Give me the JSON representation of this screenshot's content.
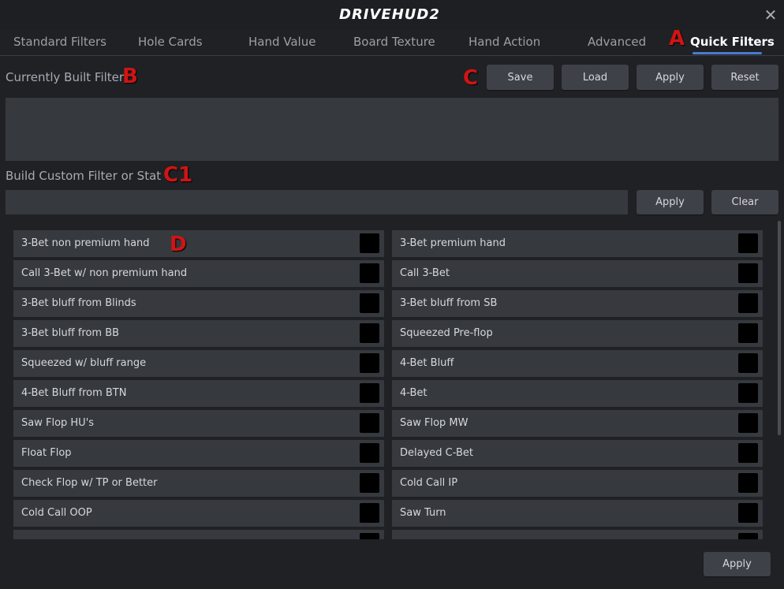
{
  "app": {
    "logo_text": "DRIVEHUD2",
    "close_glyph": "✕"
  },
  "tabs": [
    {
      "label": "Standard Filters"
    },
    {
      "label": "Hole Cards"
    },
    {
      "label": "Hand Value"
    },
    {
      "label": "Board Texture"
    },
    {
      "label": "Hand Action"
    },
    {
      "label": "Advanced"
    },
    {
      "label": "Quick Filters",
      "active": true
    }
  ],
  "markers": {
    "a": "A",
    "b": "B",
    "c": "C",
    "c1": "C1",
    "d": "D"
  },
  "current_filter": {
    "label": "Currently Built Filter",
    "buttons": {
      "save": "Save",
      "load": "Load",
      "apply": "Apply",
      "reset": "Reset"
    },
    "value": ""
  },
  "custom": {
    "label": "Build Custom Filter or Stat",
    "input_value": "",
    "buttons": {
      "apply": "Apply",
      "clear": "Clear"
    }
  },
  "quick_filters": {
    "left": [
      "3-Bet non premium hand",
      "Call 3-Bet w/ non premium hand",
      "3-Bet bluff from Blinds",
      "3-Bet bluff from BB",
      "Squeezed w/ bluff range",
      "4-Bet Bluff from BTN",
      "Saw Flop HU's",
      "Float Flop",
      "Check Flop w/ TP or Better",
      "Cold Call OOP"
    ],
    "right": [
      "3-Bet premium hand",
      "Call 3-Bet",
      "3-Bet bluff from SB",
      "Squeezed Pre-flop",
      "4-Bet Bluff",
      "4-Bet",
      "Saw Flop MW",
      "Delayed C-Bet",
      "Cold Call IP",
      "Saw Turn"
    ]
  },
  "footer": {
    "apply": "Apply"
  },
  "colors": {
    "accent": "#4a7bd0",
    "marker": "#d11414",
    "checkbox": "#000000"
  }
}
